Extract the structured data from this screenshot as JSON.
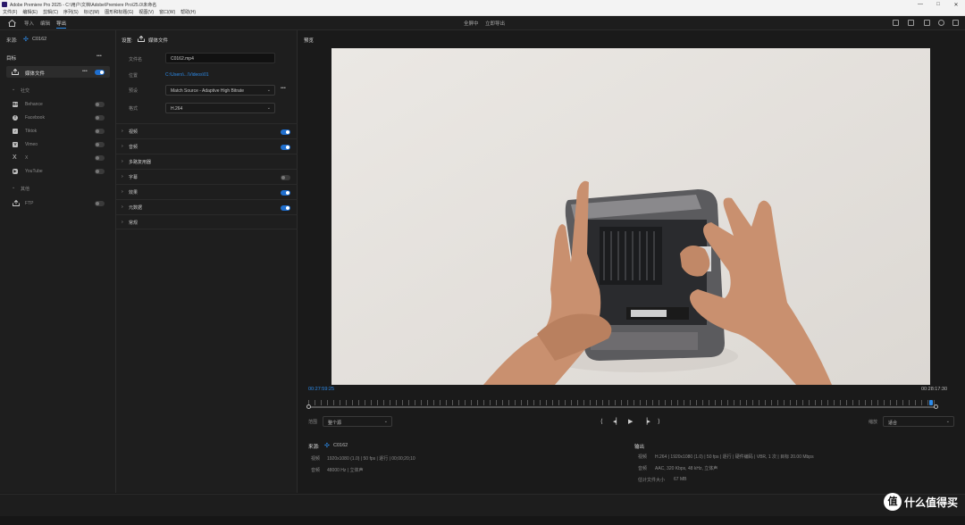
{
  "window": {
    "title": "Adobe Premiere Pro 2025 - C:\\用户\\文档\\Adobe\\Premiere Pro\\25.0\\未命名",
    "controls": [
      "—",
      "□",
      "✕"
    ]
  },
  "menu": [
    "文件(F)",
    "编辑(E)",
    "剪辑(C)",
    "序列(S)",
    "标记(M)",
    "图形和标题(G)",
    "视图(V)",
    "窗口(W)",
    "帮助(H)"
  ],
  "header": {
    "tabs": [
      "导入",
      "编辑",
      "导出"
    ],
    "active_tab": 2,
    "center_left": "全屏中",
    "center_right": "立即导出"
  },
  "left": {
    "source_label": "来源:",
    "source_name": "C0162",
    "dest_title": "目标",
    "more": "•••",
    "media_file": "媒体文件",
    "social_section": "社交",
    "social": [
      {
        "name": "Behance",
        "icon": "Be"
      },
      {
        "name": "Facebook",
        "icon": "f"
      },
      {
        "name": "Tiktok",
        "icon": "♪"
      },
      {
        "name": "Vimeo",
        "icon": "V"
      },
      {
        "name": "X",
        "icon": "X"
      },
      {
        "name": "YouTube",
        "icon": "▶"
      }
    ],
    "other_section": "其他",
    "ftp": "FTP"
  },
  "settings": {
    "title_label": "设置:",
    "title_value": "媒体文件",
    "filename_label": "文件名",
    "filename_value": "C0162.mp4",
    "location_label": "位置",
    "location_value": "C:\\Users\\...\\Videos\\01",
    "preset_label": "预设",
    "preset_value": "Match Source - Adaptive High Bitrate",
    "format_label": "格式",
    "format_value": "H.264",
    "sections": [
      {
        "name": "视频",
        "toggle": true
      },
      {
        "name": "音频",
        "toggle": true
      },
      {
        "name": "多路复用器"
      },
      {
        "name": "字幕",
        "toggle": false
      },
      {
        "name": "效果",
        "toggle": true
      },
      {
        "name": "元数据",
        "toggle": true
      },
      {
        "name": "常规"
      }
    ]
  },
  "preview": {
    "title": "预览",
    "current_time": "00:27:59:25",
    "end_time": "00:28:17:30",
    "range_label": "范围",
    "range_value": "整个源",
    "zoom_label": "缩放",
    "zoom_value": "适合",
    "scrub_position": 0.992
  },
  "summary": {
    "source_label": "来源:",
    "source_name": "C0162",
    "video_key": "视频",
    "video_value": "1920x1080 (1.0) | 50 fps | 逐行 | 00;00;20;10",
    "audio_key": "音频",
    "audio_value": "48000 Hz | 立体声",
    "output_label": "输出",
    "out_video_key": "视频",
    "out_video_value": "H.264 | 1920x1080 (1.0) | 50 fps | 逐行 | 硬件编码 | VBR, 1 次 | 目标 20.00 Mbps",
    "out_audio_key": "音频",
    "out_audio_value": "AAC, 320 Kbps, 48 kHz, 立体声",
    "size_key": "估计文件大小",
    "size_value": "67 MB"
  },
  "watermark": {
    "logo": "值",
    "text": "什么值得买"
  }
}
